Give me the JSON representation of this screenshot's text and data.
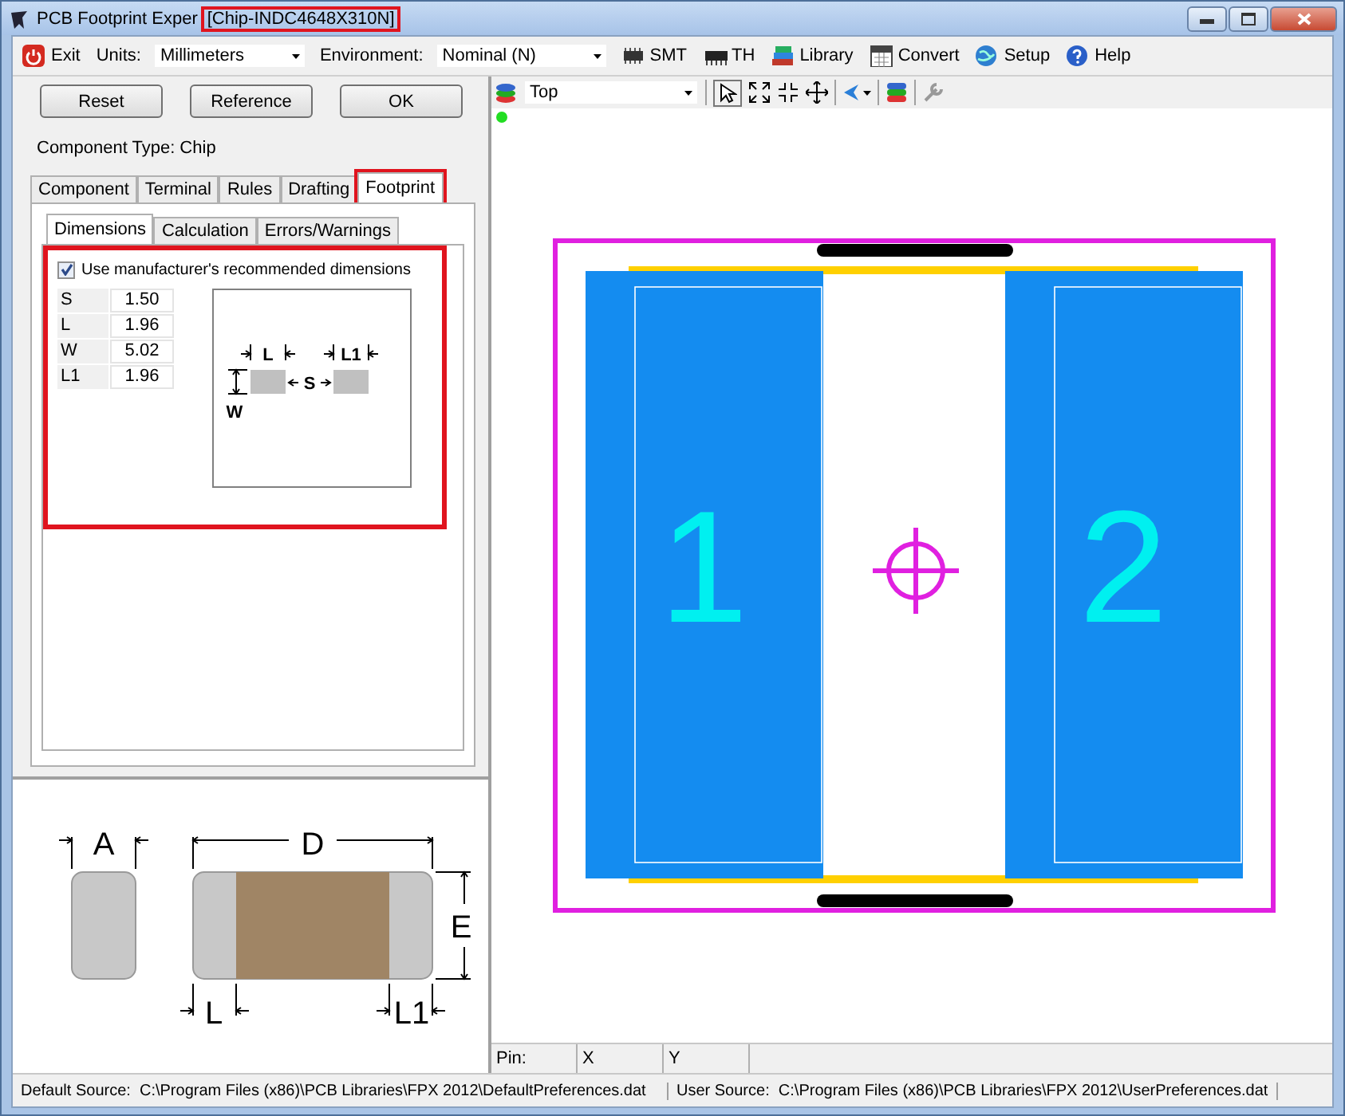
{
  "window": {
    "title": "PCB Footprint Exper",
    "document": "[Chip-INDC4648X310N]",
    "document_highlighted": true
  },
  "toolbar": [
    {
      "kind": "button",
      "label": "Exit"
    },
    {
      "kind": "label",
      "label": "Units:"
    },
    {
      "kind": "dropdown",
      "value": "Millimeters"
    },
    {
      "kind": "label",
      "label": "Environment:"
    },
    {
      "kind": "dropdown",
      "value": "Nominal (N)"
    },
    {
      "kind": "button",
      "label": "SMT"
    },
    {
      "kind": "button",
      "label": "TH"
    },
    {
      "kind": "button",
      "label": "Library"
    },
    {
      "kind": "button",
      "label": "Convert"
    },
    {
      "kind": "button",
      "label": "Setup"
    },
    {
      "kind": "button",
      "label": "Help"
    }
  ],
  "buttons": [
    "Reset",
    "Reference",
    "OK"
  ],
  "component_type": "Component Type: Chip",
  "tabs": [
    {
      "label": "Component",
      "selected": false,
      "highlighted": false
    },
    {
      "label": "Terminal",
      "selected": false,
      "highlighted": false
    },
    {
      "label": "Rules",
      "selected": false,
      "highlighted": false
    },
    {
      "label": "Drafting",
      "selected": false,
      "highlighted": false
    },
    {
      "label": "Footprint",
      "selected": true,
      "highlighted": true
    }
  ],
  "subtabs": [
    {
      "label": "Dimensions",
      "selected": true
    },
    {
      "label": "Calculation",
      "selected": false
    },
    {
      "label": "Errors/Warnings",
      "selected": false
    }
  ],
  "dimensions": {
    "highlighted": true,
    "checkbox": {
      "label": "Use manufacturer's recommended dimensions",
      "checked": true
    },
    "rows": [
      {
        "name": "S",
        "value": "1.50"
      },
      {
        "name": "L",
        "value": "1.96"
      },
      {
        "name": "W",
        "value": "5.02"
      },
      {
        "name": "L1",
        "value": "1.96"
      }
    ],
    "diagram_labels": {
      "l": "L",
      "l1": "L1",
      "s": "S",
      "w": "W"
    }
  },
  "chip_drawing": {
    "a": "A",
    "d": "D",
    "e": "E",
    "l": "L",
    "l1": "L1"
  },
  "canvas_toolbar": {
    "layer": "Top"
  },
  "canvas": {
    "pads": [
      "1",
      "2"
    ]
  },
  "pin_bar": [
    "Pin:",
    "X",
    "Y"
  ],
  "status_bar": [
    "Default Source:  C:\\Program Files (x86)\\PCB Libraries\\FPX 2012\\DefaultPreferences.dat",
    "User Source:  C:\\Program Files (x86)\\PCB Libraries\\FPX 2012\\UserPreferences.dat"
  ]
}
